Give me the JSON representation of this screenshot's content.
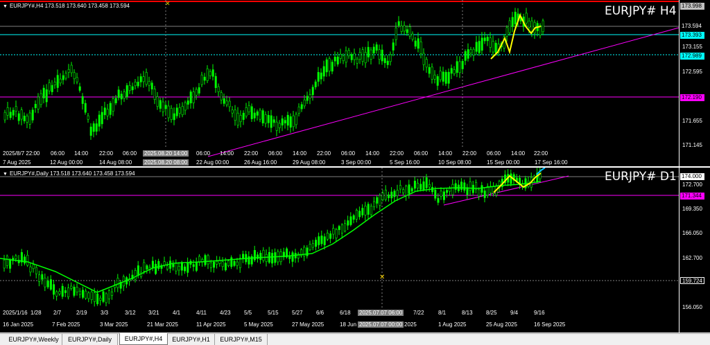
{
  "h4": {
    "header": "EURJPY#,H4  173.518 173.640 173.458 173.594",
    "watermark": "EURJPY# H4",
    "price_ticks": [
      "173.998",
      "173.594",
      "173.393",
      "173.155",
      "172.989",
      "172.595",
      "172.190",
      "171.655",
      "171.145"
    ],
    "time_labels": [
      "7 Aug 2025",
      "12 Aug 00:00",
      "14 Aug 08:00",
      "2025.08.20 08:00",
      "22 Aug 00:00",
      "26 Aug 16:00",
      "29 Aug 08:00",
      "3 Sep 00:00",
      "5 Sep 16:00",
      "10 Sep 08:00",
      "15 Sep 00:00",
      "17 Sep 16:00"
    ],
    "upper_labels": [
      "2025/8/7 22:00",
      "06:00",
      "14:00",
      "22:00",
      "06:00",
      "2025.08.20 14:00",
      "06:00",
      "14:00",
      "22:00",
      "06:00",
      "14:00",
      "22:00",
      "06:00",
      "14:00",
      "22:00",
      "06:00",
      "14:00",
      "22:00",
      "06:00",
      "14:00",
      "22:00"
    ],
    "colors": {
      "cyan": "#00ffff",
      "magenta": "#ff00ff",
      "yellow": "#ffff00",
      "candle": "#00ff00",
      "red": "#ff0000"
    }
  },
  "d1": {
    "header": "EURJPY#,Daily  173.518 173.640 173.458 173.594",
    "watermark": "EURJPY# D1",
    "price_ticks": [
      "174.000",
      "172.700",
      "171.344",
      "169.350",
      "166.050",
      "162.700",
      "159.724",
      "156.050"
    ],
    "time_labels": [
      "16 Jan 2025",
      "7 Feb 2025",
      "3 Mar 2025",
      "21 Mar 2025",
      "11 Apr 2025",
      "5 May 2025",
      "27 May 2025",
      "18 Jun",
      "2025.07.07 00:00",
      "2025",
      "1 Aug 2025",
      "25 Aug 2025",
      "16 Sep 2025"
    ],
    "upper_labels": [
      "2025/1/16",
      "1/28",
      "2/7",
      "2/19",
      "3/3",
      "3/12",
      "3/21",
      "4/1",
      "4/11",
      "4/23",
      "5/5",
      "5/15",
      "5/27",
      "6/6",
      "6/18",
      "2025.07.07 06:00",
      "7/22",
      "8/1",
      "8/13",
      "8/25",
      "9/4",
      "9/16"
    ]
  },
  "tabs": [
    "EURJPY#,Weekly",
    "EURJPY#,Daily",
    "EURJPY#,H4",
    "EURJPY#,H1",
    "EURJPY#,M15"
  ],
  "active_tab": "EURJPY#,H4"
}
